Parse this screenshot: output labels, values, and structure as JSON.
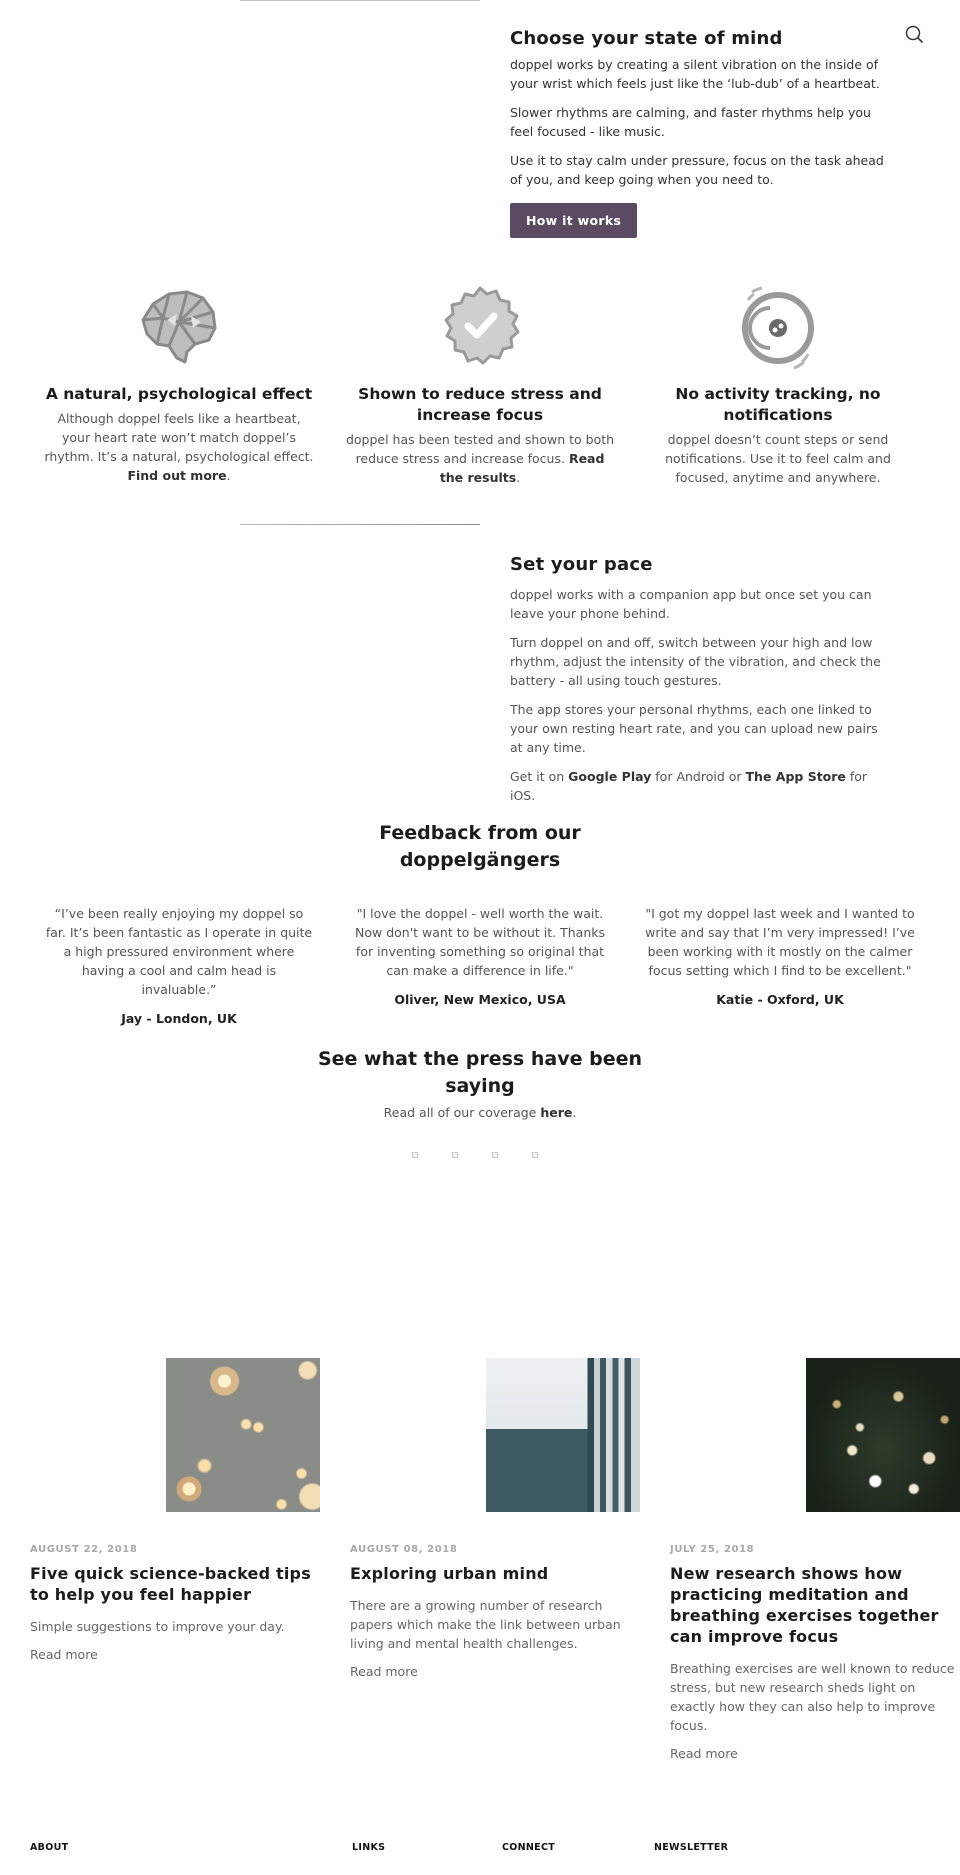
{
  "accent_color": "#5a4a62",
  "header": {
    "search_icon": "search-icon"
  },
  "state_of_mind": {
    "title": "Choose your state of mind",
    "paragraphs": [
      "doppel works by creating a silent vibration on the inside of your wrist which feels just like the ‘lub-dub’ of a heartbeat.",
      "Slower rhythms are calming, and faster rhythms help you feel focused - like music.",
      "Use it to stay calm under pressure, focus on the task ahead of you, and keep going when you need to."
    ],
    "button_label": "How it works"
  },
  "features": [
    {
      "icon": "brain-icon",
      "title": "A natural, psychological effect",
      "text": "Although doppel feels like a heartbeat, your heart rate won’t match doppel’s rhythm. It’s a natural, psychological effect. ",
      "link": "Find out more",
      "suffix": "."
    },
    {
      "icon": "badge-check-icon",
      "title": "Shown to reduce stress and increase focus",
      "text": "doppel has been tested and shown to both reduce stress and increase focus. ",
      "link": "Read the results",
      "suffix": "."
    },
    {
      "icon": "vibrating-device-icon",
      "title": "No activity tracking, no notifications",
      "text": "doppel doesn’t count steps or send notifications. Use it to feel calm and focused, anytime and anywhere."
    }
  ],
  "set_pace": {
    "title": "Set your pace",
    "paragraphs": [
      "doppel works with a companion app but once set you can leave your phone behind.",
      "Turn doppel on and off, switch between your high and low rhythm, adjust the intensity of the vibration, and check the battery - all using touch gestures.",
      "The app stores your personal rhythms, each one linked to your own resting heart rate, and you can upload new pairs at any time."
    ],
    "get_it": {
      "prefix": "Get it on ",
      "google_play": "Google Play",
      "middle": " for Android or ",
      "app_store": "The App Store",
      "suffix": " for iOS."
    }
  },
  "feedback": {
    "title": "Feedback from our doppelgängers",
    "quotes": [
      {
        "text": "“I’ve been really enjoying my doppel so far. It’s been fantastic as I operate in quite a high pressured environment where having a cool and calm head is invaluable.”",
        "author": "Jay - London, UK"
      },
      {
        "text": "\"I love the doppel - well worth the wait. Now don't want to be without it. Thanks for inventing something so original that can make a difference in life.\"",
        "author": "Oliver, New Mexico, USA"
      },
      {
        "text": "\"I got my doppel last week and I wanted to write and say that I’m very impressed! I’ve been working with it mostly on the calmer focus setting which I find to be excellent.\"",
        "author": "Katie - Oxford, UK"
      }
    ]
  },
  "press": {
    "title": "See what the press have been saying",
    "sub_prefix": "Read all of our coverage ",
    "sub_link": "here",
    "sub_suffix": ".",
    "carousel_dots": 4
  },
  "posts": [
    {
      "image": "hanging-light-bulbs-photo",
      "date": "AUGUST 22, 2018",
      "title": "Five quick science-backed tips to help you feel happier",
      "excerpt": "Simple suggestions to improve your day.",
      "read_more": "Read more"
    },
    {
      "image": "glass-building-photo",
      "date": "AUGUST 08, 2018",
      "title": "Exploring urban mind",
      "excerpt": "There are a growing number of research papers which make the link between urban living and mental health challenges.",
      "read_more": "Read more"
    },
    {
      "image": "bokeh-foliage-photo",
      "date": "JULY 25, 2018",
      "title": "New research shows how practicing meditation and breathing exercises together can improve focus",
      "excerpt": "Breathing exercises are well known to reduce stress, but new research sheds light on exactly how they can also help to improve focus.",
      "read_more": "Read more"
    }
  ],
  "footer": {
    "headings": [
      "ABOUT",
      "LINKS",
      "CONNECT",
      "NEWSLETTER"
    ]
  }
}
